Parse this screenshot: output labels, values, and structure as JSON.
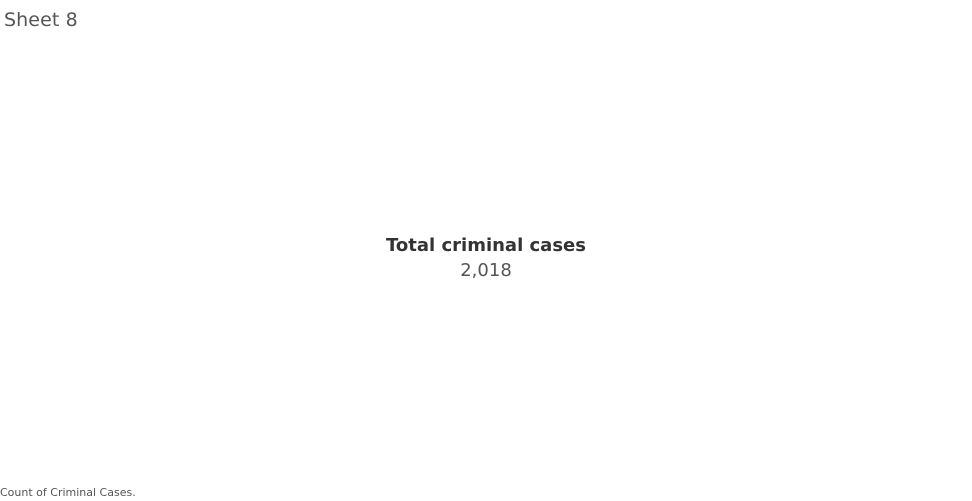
{
  "sheet": {
    "title": "Sheet 8"
  },
  "kpi": {
    "label": "Total criminal cases",
    "value": "2,018"
  },
  "caption": {
    "text": "Count of Criminal Cases."
  },
  "colors": {
    "background": "#ffffff",
    "text_primary": "#333333",
    "text_secondary": "#555555"
  }
}
